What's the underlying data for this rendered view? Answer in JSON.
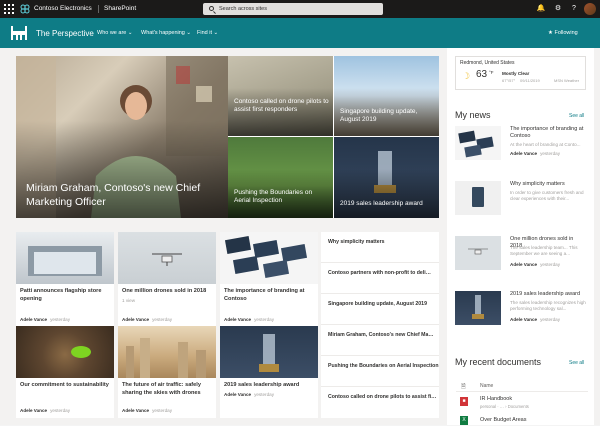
{
  "suite": {
    "brand": "Contoso Electronics",
    "app": "SharePoint",
    "search_placeholder": "Search across sites"
  },
  "site": {
    "title": "The Perspective",
    "nav": [
      "Who we are",
      "What's happening",
      "Find it"
    ],
    "following": "Following"
  },
  "hero": {
    "main": "Miriam Graham, Contoso's new Chief Marketing Officer",
    "tiles": [
      "Contoso called on drone pilots to assist first responders",
      "Singapore building update, August 2019",
      "Pushing the Boundaries on Aerial Inspection",
      "2019 sales leadership award"
    ]
  },
  "news": [
    {
      "title": "Patti announces flagship store opening",
      "author": "Adele Vance",
      "time": "yesterday",
      "views": ""
    },
    {
      "title": "One million drones sold in 2018",
      "author": "Adele Vance",
      "time": "yesterday",
      "views": "1 view"
    },
    {
      "title": "The importance of branding at Contoso",
      "author": "Adele Vance",
      "time": "yesterday",
      "views": ""
    },
    {
      "title": "Our commitment to sustainability",
      "author": "Adele Vance",
      "time": "yesterday",
      "views": ""
    },
    {
      "title": "The future of air traffic: safely sharing the skies with drones",
      "author": "Adele Vance",
      "time": "yesterday",
      "views": ""
    },
    {
      "title": "2019 sales leadership award",
      "author": "Adele Vance",
      "time": "yesterday",
      "views": ""
    }
  ],
  "list": [
    "Why simplicity matters",
    "Contoso partners with non-profit to deli…",
    "Singapore building update, August 2019",
    "Miriam Graham, Contoso's new Chief Ma…",
    "Pushing the Boundaries on Aerial Inspection",
    "Contoso called on drone pilots to assist fi…"
  ],
  "weather": {
    "location": "Redmond, United States",
    "temp": "63",
    "unit": "°F",
    "condition": "Mostly Clear",
    "range": "67°/57°",
    "date": "09/11/2019",
    "source": "MSN Weather"
  },
  "my_news": {
    "heading": "My news",
    "see_all": "See all",
    "items": [
      {
        "title": "The importance of branding at Contoso",
        "summary": "At the heart of branding at Conto...",
        "author": "Adele Vance",
        "time": "yesterday"
      },
      {
        "title": "Why simplicity matters",
        "summary": "In order to give customers fresh and clear experiences with their...",
        "author": "",
        "time": ""
      },
      {
        "title": "One million drones sold in 2018",
        "summary": "The sales leadership team... This September we are seeing a...",
        "author": "Adele Vance",
        "time": "yesterday"
      },
      {
        "title": "2019 sales leadership award",
        "summary": "The sales leadership recognizes high performing technology sal...",
        "author": "Adele Vance",
        "time": "yesterday"
      }
    ]
  },
  "recent_docs": {
    "heading": "My recent documents",
    "see_all": "See all",
    "col_name": "Name",
    "items": [
      {
        "name": "IR Handbook",
        "meta": "personal · … › Documents"
      },
      {
        "name": "Over Budget Areas",
        "meta": ""
      }
    ]
  }
}
